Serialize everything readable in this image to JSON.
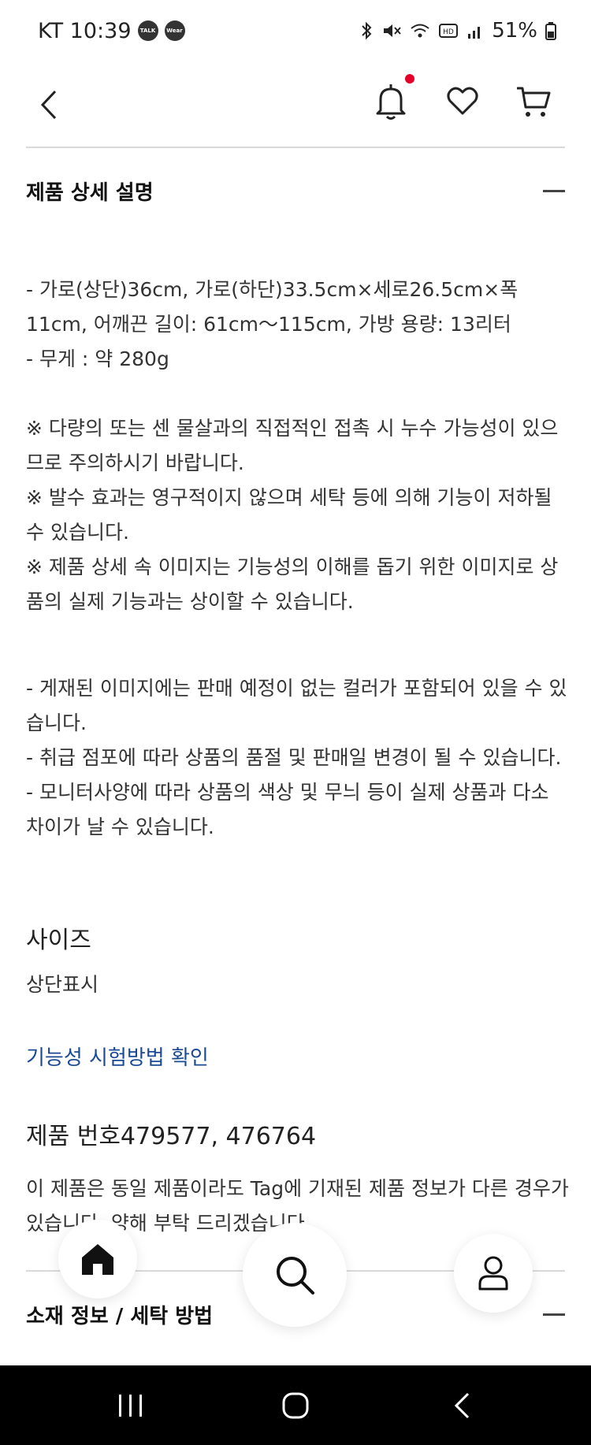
{
  "status_bar": {
    "carrier_time": "KT 10:39",
    "badge_talk": "TALK",
    "badge_wear": "Wear",
    "battery": "51%",
    "icons": [
      "bluetooth-icon",
      "mute-icon",
      "wifi-icon",
      "hd-icon",
      "signal-icon",
      "battery-icon"
    ]
  },
  "header": {
    "icons": [
      "back-chevron-icon",
      "bell-icon",
      "heart-icon",
      "cart-icon"
    ],
    "notification_dot_color": "#e5002b"
  },
  "detail_section": {
    "title": "제품 상세 설명",
    "specs": [
      "- 가로(상단)36cm, 가로(하단)33.5cm×세로26.5cm×폭11cm, 어깨끈 길이: 61cm〜115cm, 가방 용량: 13리터",
      "- 무게 : 약 280g"
    ],
    "notices": [
      "※ 다량의 또는 센 물살과의 직접적인 접촉 시 누수 가능성이 있으므로 주의하시기 바랍니다.",
      "※ 발수 효과는 영구적이지 않으며 세탁 등에 의해 기능이 저하될 수 있습니다.",
      "※ 제품 상세 속 이미지는 기능성의 이해를 돕기 위한 이미지로 상품의 실제 기능과는 상이할 수 있습니다."
    ],
    "disclaimers": [
      "- 게재된 이미지에는 판매 예정이 없는 컬러가 포함되어 있을 수 있습니다.",
      "- 취급 점포에 따라 상품의 품절 및 판매일 변경이 될 수 있습니다.",
      "- 모니터사양에 따라 상품의 색상 및 무늬 등이 실제 상품과 다소 차이가 날 수 있습니다."
    ],
    "size_heading": "사이즈",
    "size_value": "상단표시",
    "test_method_link": "기능성 시험방법 확인",
    "product_number": "제품 번호479577, 476764",
    "product_note": "이 제품은 동일 제품이라도 Tag에 기재된 제품 정보가 다른 경우가 있습니다. 양해 부탁 드리겠습니다."
  },
  "material_section": {
    "title": "소재 정보 / 세탁 방법"
  },
  "floating_nav": [
    "home-icon",
    "search-icon",
    "user-icon"
  ],
  "system_nav": [
    "recent-apps-icon",
    "home-circle-icon",
    "back-icon"
  ],
  "colors": {
    "link": "#1a4a94",
    "divider": "#dadada",
    "system_nav_bg": "#000000"
  }
}
